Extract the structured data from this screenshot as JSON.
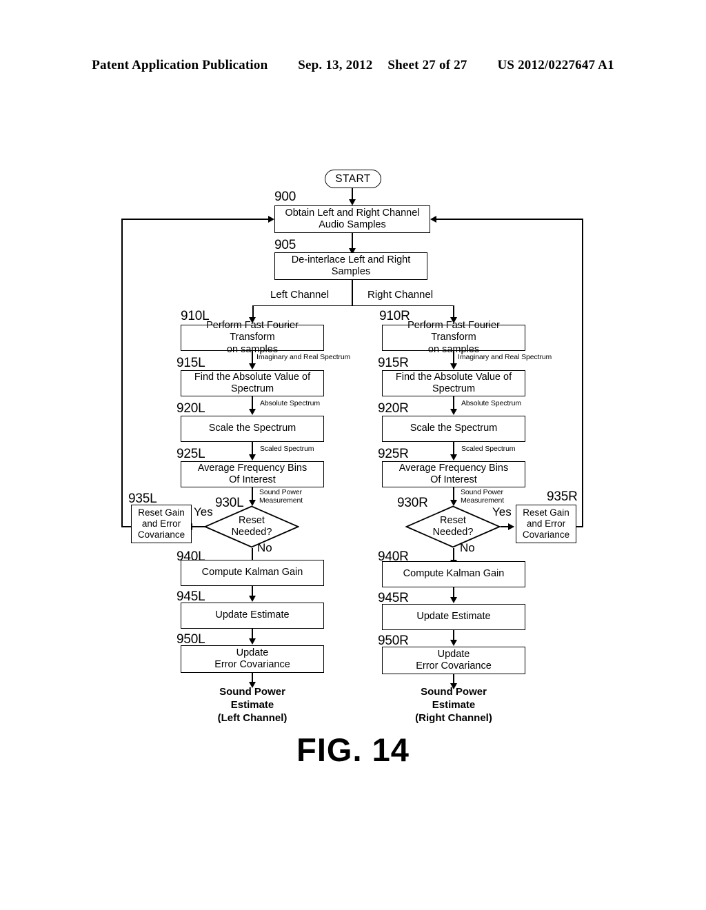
{
  "header": {
    "publication": "Patent Application Publication",
    "date": "Sep. 13, 2012",
    "sheet": "Sheet 27 of 27",
    "patent_number": "US 2012/0227647 A1"
  },
  "figure": {
    "caption": "FIG. 14",
    "start_label": "START"
  },
  "common": {
    "box_900": {
      "ref": "900",
      "line1": "Obtain Left and Right Channel",
      "line2": "Audio Samples"
    },
    "box_905": {
      "ref": "905",
      "line1": "De-interlace Left and Right",
      "line2": "Samples"
    },
    "branch_left_label": "Left Channel",
    "branch_right_label": "Right Channel"
  },
  "left_channel": {
    "fft": {
      "ref": "910L",
      "line1": "Perform Fast Fourier Transform",
      "line2": "on samples"
    },
    "edge_fft_out": {
      "line1": "Imaginary and Real Spectrum"
    },
    "absolute": {
      "ref": "915L",
      "line1": "Find the Absolute Value of",
      "line2": "Spectrum"
    },
    "edge_abs_out": {
      "line1": "Absolute Spectrum"
    },
    "scale": {
      "ref": "920L",
      "line1": "Scale the Spectrum"
    },
    "edge_scale_out": {
      "line1": "Scaled Spectrum"
    },
    "average": {
      "ref": "925L",
      "line1": "Average Frequency Bins",
      "line2": "Of Interest"
    },
    "edge_avg_out": {
      "line1": "Sound Power",
      "line2": "Measurement"
    },
    "decision": {
      "ref": "930L",
      "line1": "Reset",
      "line2": "Needed?",
      "yes_label": "Yes",
      "no_label": "No"
    },
    "reset": {
      "ref": "935L",
      "line1": "Reset Gain",
      "line2": "and Error",
      "line3": "Covariance"
    },
    "kalman": {
      "ref": "940L",
      "line1": "Compute Kalman Gain"
    },
    "update_estimate": {
      "ref": "945L",
      "line1": "Update Estimate"
    },
    "update_covariance": {
      "ref": "950L",
      "line1": "Update",
      "line2": "Error Covariance"
    },
    "terminal": {
      "line1": "Sound Power",
      "line2": "Estimate",
      "line3": "(Left Channel)"
    }
  },
  "right_channel": {
    "fft": {
      "ref": "910R",
      "line1": "Perform Fast Fourier Transform",
      "line2": "on samples"
    },
    "edge_fft_out": {
      "line1": "Imaginary and Real Spectrum"
    },
    "absolute": {
      "ref": "915R",
      "line1": "Find the Absolute Value of",
      "line2": "Spectrum"
    },
    "edge_abs_out": {
      "line1": "Absolute Spectrum"
    },
    "scale": {
      "ref": "920R",
      "line1": "Scale the Spectrum"
    },
    "edge_scale_out": {
      "line1": "Scaled Spectrum"
    },
    "average": {
      "ref": "925R",
      "line1": "Average Frequency Bins",
      "line2": "Of Interest"
    },
    "edge_avg_out": {
      "line1": "Sound Power",
      "line2": "Measurement"
    },
    "decision": {
      "ref": "930R",
      "line1": "Reset",
      "line2": "Needed?",
      "yes_label": "Yes",
      "no_label": "No"
    },
    "reset": {
      "ref": "935R",
      "line1": "Reset Gain",
      "line2": "and Error",
      "line3": "Covariance"
    },
    "kalman": {
      "ref": "940R",
      "line1": "Compute Kalman Gain"
    },
    "update_estimate": {
      "ref": "945R",
      "line1": "Update Estimate"
    },
    "update_covariance": {
      "ref": "950R",
      "line1": "Update",
      "line2": "Error Covariance"
    },
    "terminal": {
      "line1": "Sound Power",
      "line2": "Estimate",
      "line3": "(Right Channel)"
    }
  },
  "colors": {
    "ink": "#000000",
    "paper": "#ffffff"
  }
}
